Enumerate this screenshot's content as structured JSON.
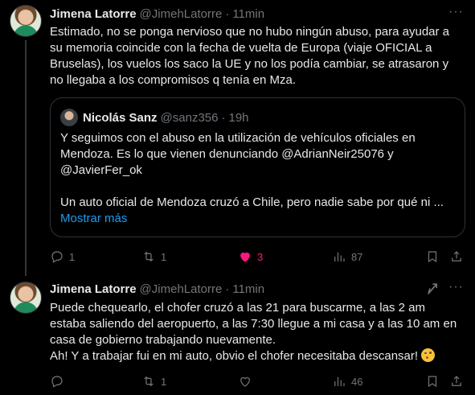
{
  "tweets": [
    {
      "author_name": "Jimena Latorre",
      "author_handle": "@JimehLatorre",
      "separator": "·",
      "time": "11min",
      "text": "Estimado, no se ponga nervioso que no hubo ningún abuso, para ayudar a\nsu memoria coincide con la fecha de vuelta de Europa (viaje OFICIAL a\nBruselas), los vuelos los saco la UE y no los podía cambiar, se atrasaron y\nno llegaba a los compromisos q tenía en Mza.",
      "quote": {
        "author_name": "Nicolás Sanz",
        "author_handle": "@sanz356",
        "separator": "·",
        "time": "19h",
        "text": "Y seguimos con el abuso en la utilización de vehículos oficiales en\nMendoza. Es lo que vienen denunciando @AdrianNeir25076 y\n@JavierFer_ok\n\nUn auto oficial de Mendoza cruzó a Chile, pero nadie sabe por qué ni ...",
        "show_more": "Mostrar más"
      },
      "actions": {
        "replies": "1",
        "reposts": "1",
        "likes": "3",
        "views": "87"
      }
    },
    {
      "author_name": "Jimena Latorre",
      "author_handle": "@JimehLatorre",
      "separator": "·",
      "time": "11min",
      "text": "Puede chequearlo, el chofer cruzó a las 21 para buscarme, a las 2 am\nestaba saliendo del aeropuerto, a las 7:30 llegue a mi casa y a las 10 am en\ncasa de gobierno trabajando nuevamente.\nAh! Y a trabajar fui en mi auto, obvio el chofer necesitaba descansar!",
      "emoji": "wink-emoji",
      "actions": {
        "replies": "",
        "reposts": "1",
        "likes": "",
        "views": "46"
      }
    }
  ],
  "icons": {
    "more": "more-horizontal-icon",
    "grok": "grok-icon"
  },
  "colors": {
    "background": "#000000",
    "text": "#e7e9ea",
    "muted": "#71767b",
    "link": "#1d9bf0",
    "like": "#f91880",
    "border": "#2f3336"
  }
}
